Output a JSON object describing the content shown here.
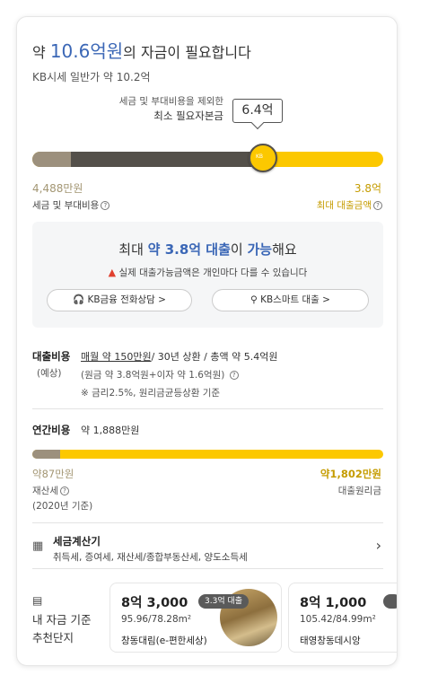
{
  "headline": {
    "prefix": "약 ",
    "amount": "10.6억원",
    "suffix": "의 자금이 필요합니다"
  },
  "kb_price": "KB시세 일반가 약 10.2억",
  "min_capital": {
    "line1": "세금 및 부대비용을 제외한",
    "line2": "최소 필요자본금",
    "bubble": "6.4억"
  },
  "funding_bar": {
    "tax_fraction": 0.11,
    "capital_fraction": 0.63,
    "knob_text": "KB"
  },
  "left_value": "4,488만원",
  "left_caption": "세금 및 부대비용",
  "right_value": "3.8억",
  "right_caption": "최대 대출금액",
  "loan": {
    "head_prefix": "최대 ",
    "head_amount": "약 3.8억 대출",
    "head_mid": "이 ",
    "head_possible": "가능",
    "head_suffix": "해요",
    "warning": "실제 대출가능금액은 개인마다 다를 수 있습니다",
    "btn_consult": "KB금융 전화상담 >",
    "btn_smart": "KB스마트 대출 >"
  },
  "loan_cost": {
    "label": "대출비용",
    "label_sub": "(예상)",
    "monthly": "매월 약 150만원",
    "rest": "/ 30년 상환 / 총액 약 5.4억원",
    "breakdown": "(원금 약 3.8억원+이자 약 1.6억원)",
    "note": "※ 금리2.5%, 원리금균등상환 기준"
  },
  "annual_cost": {
    "label": "연간비용",
    "value": "약 1,888만원",
    "tax_fraction": 0.08,
    "left_value": "약87만원",
    "left_caption": "재산세",
    "left_sub": "(2020년 기준)",
    "right_value": "약1,802만원",
    "right_caption": "대출원리금"
  },
  "tax_calc": {
    "title": "세금계산기",
    "desc": "취득세, 증여세, 재산세/종합부동산세, 양도소득세"
  },
  "recommend": {
    "title_line1": "내 자금 기준",
    "title_line2": "추천단지",
    "items": [
      {
        "price": "8억 3,000",
        "area": "95.96/78.28m²",
        "name": "창동대림(e-편한세상)",
        "badge": "3.3억 대출"
      },
      {
        "price": "8억 1,000",
        "area": "105.42/84.99m²",
        "name": "태영창동데시앙",
        "badge": ""
      }
    ]
  },
  "colors": {
    "accent_blue": "#3b67b6",
    "kb_yellow": "#fcc800",
    "dark_brown": "#54504a",
    "taupe": "#9c907d",
    "gold_text": "#c59c00"
  }
}
